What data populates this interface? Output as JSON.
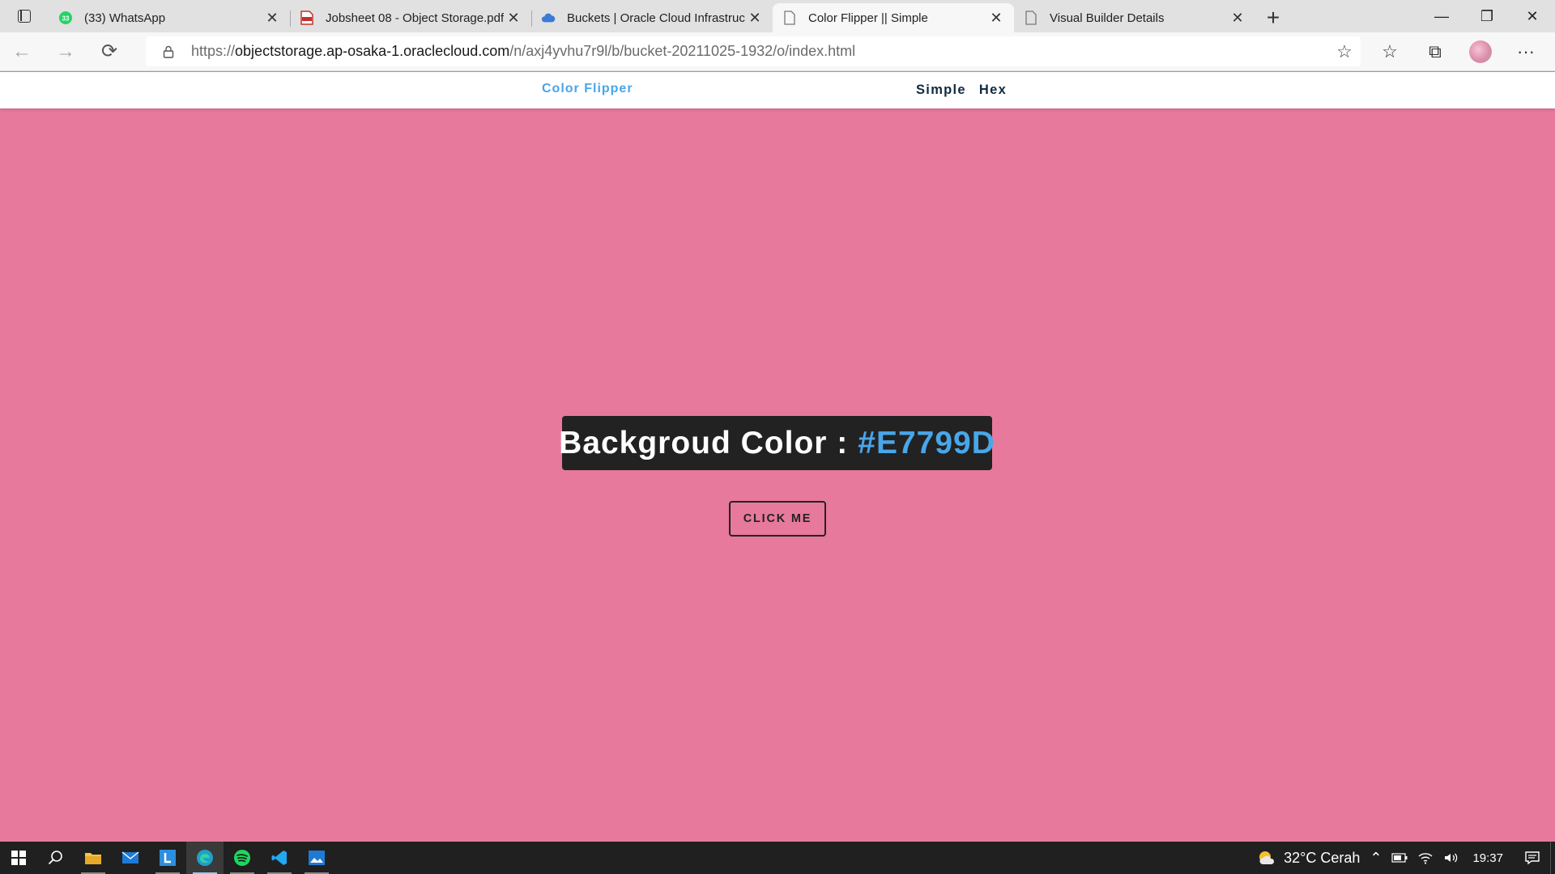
{
  "browser": {
    "tabs": [
      {
        "title": "(33) WhatsApp",
        "icon": "whatsapp-icon",
        "active": false
      },
      {
        "title": "Jobsheet 08 - Object Storage.pdf",
        "icon": "pdf-icon",
        "active": false
      },
      {
        "title": "Buckets | Oracle Cloud Infrastruc",
        "icon": "cloud-icon",
        "active": false
      },
      {
        "title": "Color Flipper || Simple",
        "icon": "page-icon",
        "active": true
      },
      {
        "title": "Visual Builder Details",
        "icon": "page-icon",
        "active": false
      }
    ],
    "whatsapp_badge": "33",
    "address": {
      "scheme": "https://",
      "host": "objectstorage.ap-osaka-1.oraclecloud.com",
      "path": "/n/axj4yvhu7r9l/b/bucket-20211025-1932/o/index.html"
    }
  },
  "site": {
    "brand": "Color Flipper",
    "nav_links": [
      "Simple",
      "Hex"
    ]
  },
  "main": {
    "label": "Backgroud Color :",
    "color_value": "#E7799D",
    "button_label": "click me",
    "background_color": "#E7799D"
  },
  "taskbar": {
    "weather": "32°C  Cerah",
    "time": "19:37"
  },
  "colors": {
    "brand_blue": "#49a6e9",
    "dark": "#222222",
    "nav_text": "#102a42"
  }
}
